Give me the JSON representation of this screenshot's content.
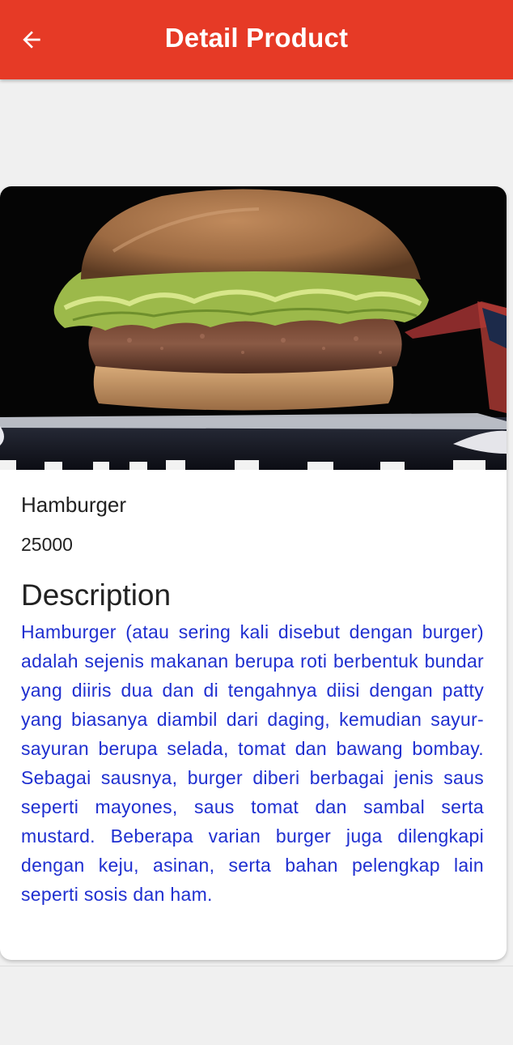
{
  "appbar": {
    "title": "Detail Product",
    "back_icon": "arrow-back-icon",
    "color": "#e63a26"
  },
  "product": {
    "image_alt": "Hamburger",
    "name": "Hamburger",
    "price": "25000",
    "description_heading": "Description",
    "description": "Hamburger (atau sering kali disebut dengan burger) adalah sejenis makanan berupa roti berbentuk bundar yang diiris dua dan di tengahnya diisi dengan patty yang biasanya diambil dari daging, kemudian sayur-sayuran berupa selada, tomat dan bawang bombay. Sebagai sausnya, burger diberi berbagai jenis saus seperti mayones, saus tomat dan sambal serta mustard. Beberapa varian burger juga dilengkapi dengan keju, asinan, serta bahan pelengkap lain seperti sosis dan ham.",
    "description_color": "#1f2fd0"
  }
}
